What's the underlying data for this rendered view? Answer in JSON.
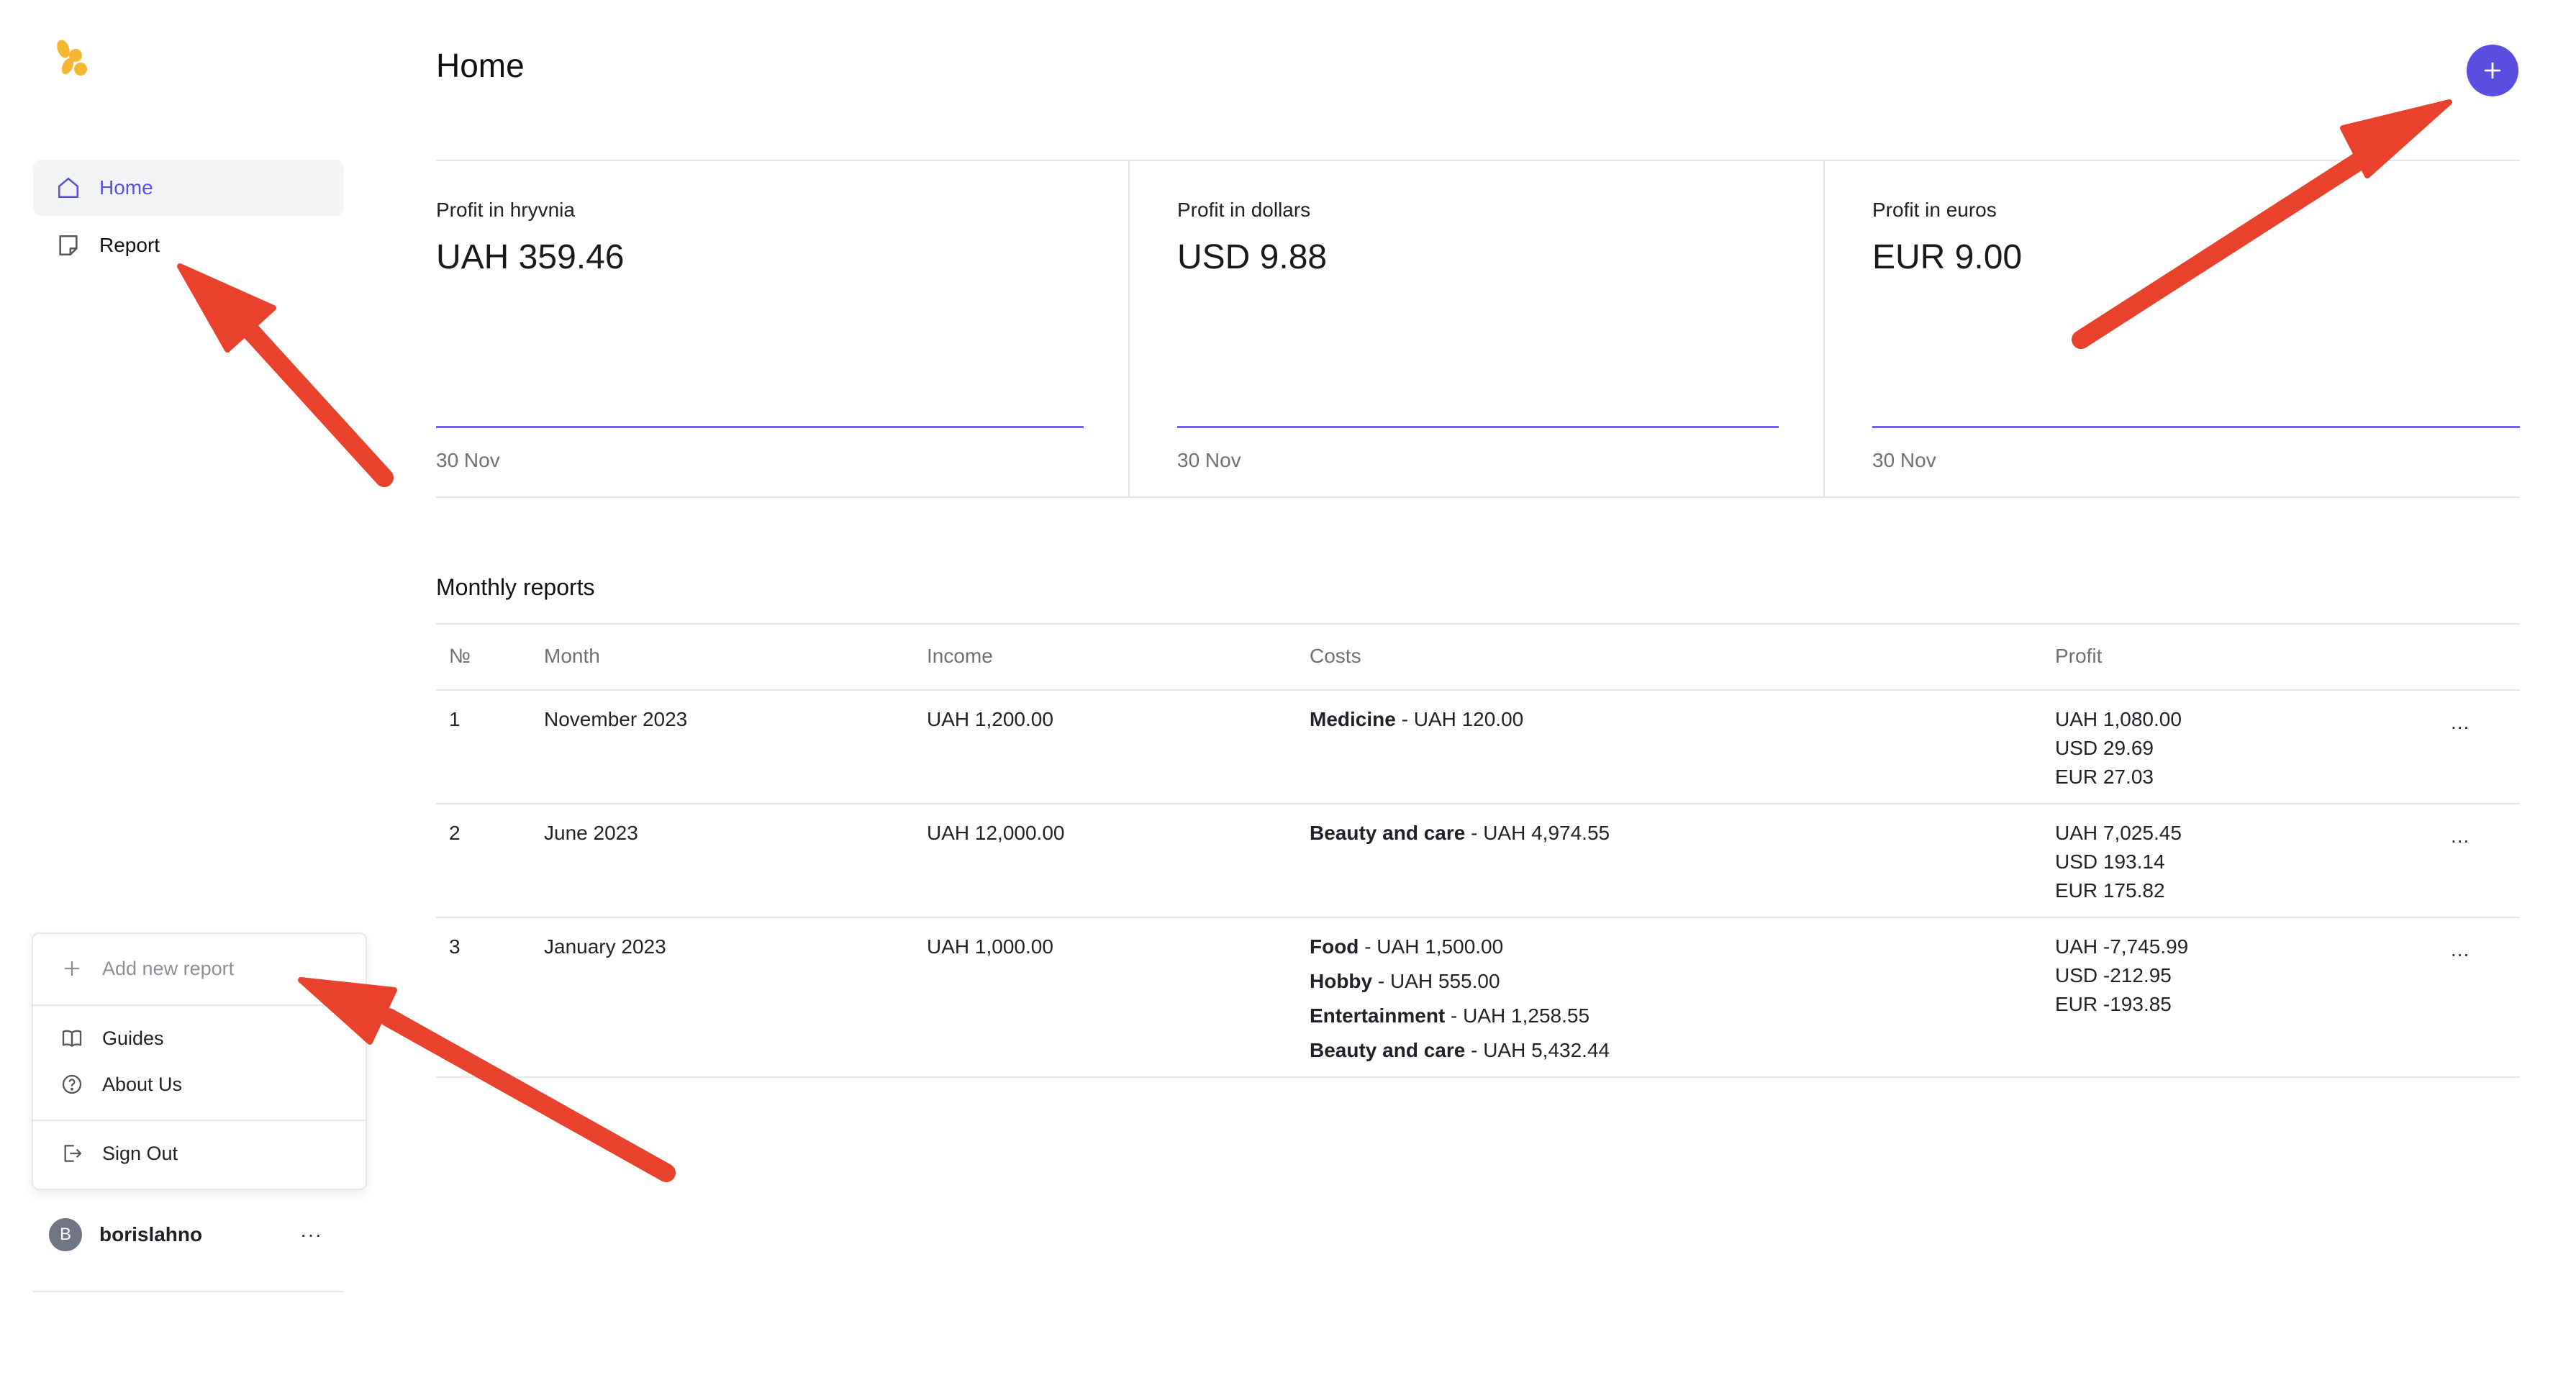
{
  "sidebar": {
    "nav": [
      {
        "label": "Home",
        "icon": "home-icon",
        "active": true
      },
      {
        "label": "Report",
        "icon": "report-icon",
        "active": false
      }
    ],
    "popup": {
      "add_new_report": "Add new report",
      "guides": "Guides",
      "about_us": "About Us",
      "sign_out": "Sign Out"
    },
    "user": {
      "initial": "B",
      "name": "borislahno",
      "more": "···"
    }
  },
  "header": {
    "title": "Home"
  },
  "cards": [
    {
      "label": "Profit in hryvnia",
      "value": "UAH 359.46",
      "date": "30 Nov"
    },
    {
      "label": "Profit in dollars",
      "value": "USD 9.88",
      "date": "30 Nov"
    },
    {
      "label": "Profit in euros",
      "value": "EUR 9.00",
      "date": "30 Nov"
    }
  ],
  "monthly_reports": {
    "title": "Monthly reports",
    "columns": [
      "№",
      "Month",
      "Income",
      "Costs",
      "Profit"
    ],
    "rows": [
      {
        "no": "1",
        "month": "November 2023",
        "income": "UAH 1,200.00",
        "costs": [
          {
            "category": "Medicine",
            "amount": "- UAH 120.00"
          }
        ],
        "profit": [
          "UAH 1,080.00",
          "USD 29.69",
          "EUR 27.03"
        ],
        "more": "..."
      },
      {
        "no": "2",
        "month": "June 2023",
        "income": "UAH 12,000.00",
        "costs": [
          {
            "category": "Beauty and care",
            "amount": "- UAH 4,974.55"
          }
        ],
        "profit": [
          "UAH 7,025.45",
          "USD 193.14",
          "EUR 175.82"
        ],
        "more": "..."
      },
      {
        "no": "3",
        "month": "January 2023",
        "income": "UAH 1,000.00",
        "costs": [
          {
            "category": "Food",
            "amount": "- UAH 1,500.00"
          },
          {
            "category": "Hobby",
            "amount": "- UAH 555.00"
          },
          {
            "category": "Entertainment",
            "amount": "- UAH 1,258.55"
          },
          {
            "category": "Beauty and care",
            "amount": "- UAH 5,432.44"
          }
        ],
        "profit": [
          "UAH -7,745.99",
          "USD -212.95",
          "EUR -193.85"
        ],
        "more": "..."
      }
    ]
  },
  "colors": {
    "accent": "#5a4fe0",
    "annotation": "#e8412c",
    "logo": "#f5b731"
  }
}
